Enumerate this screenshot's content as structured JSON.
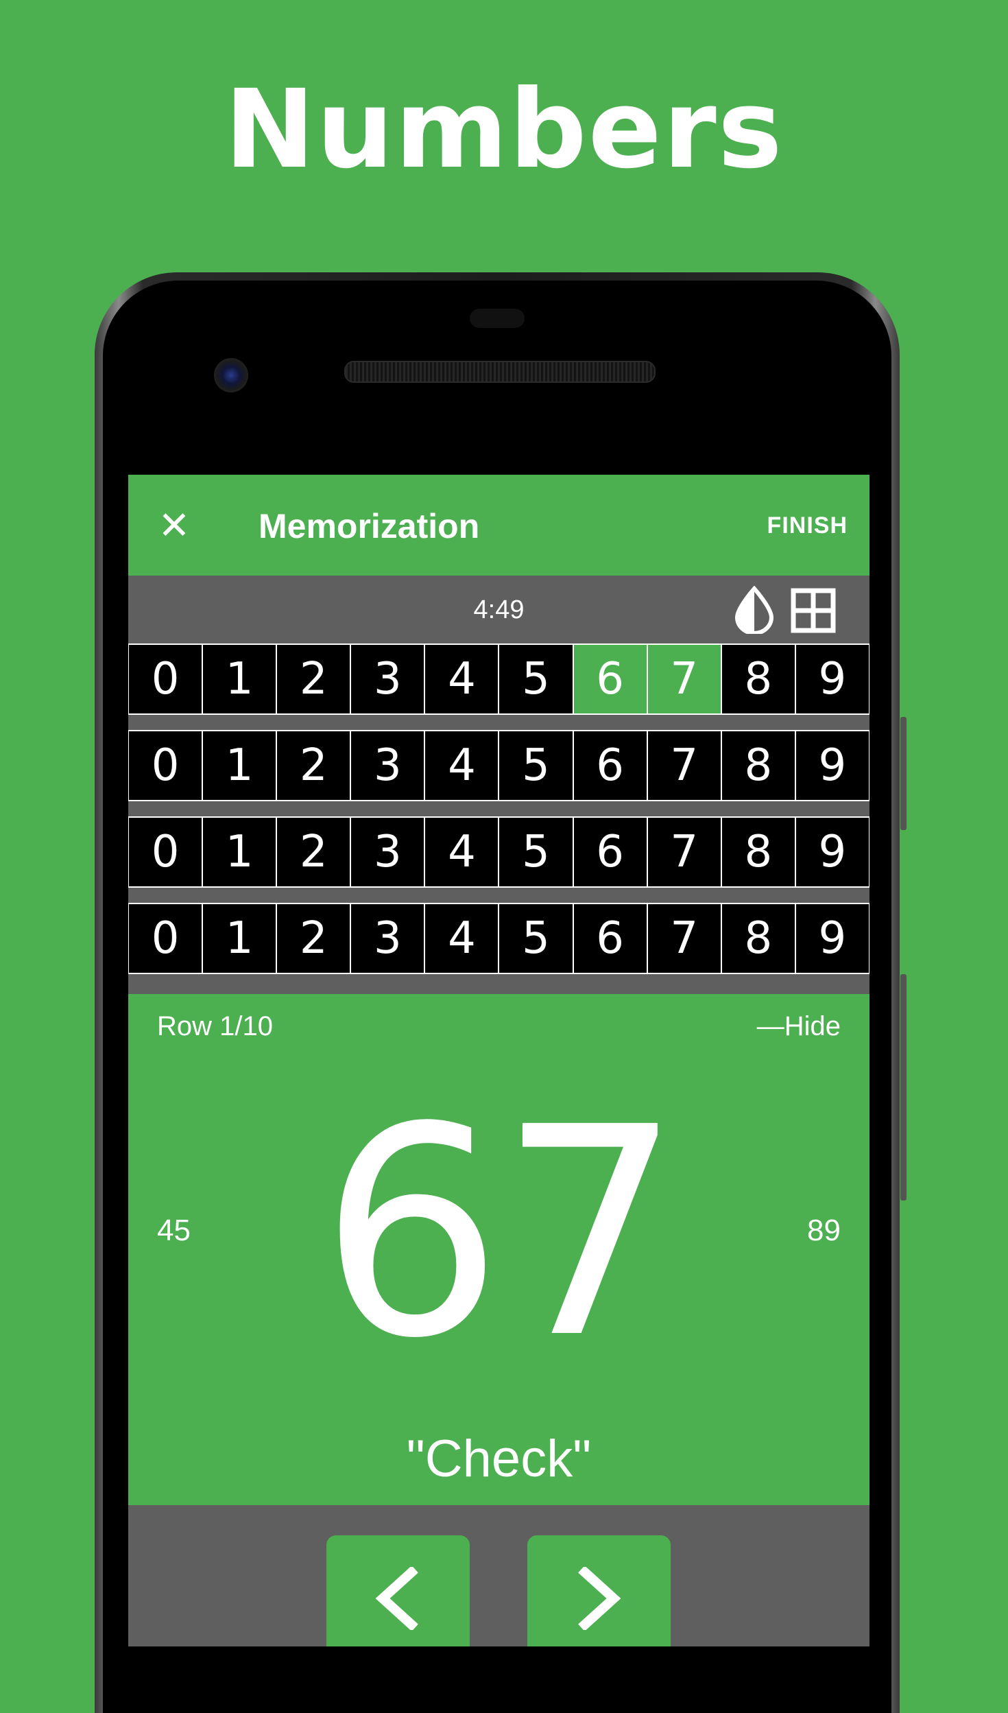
{
  "headline": "Numbers",
  "appbar": {
    "close_icon": "close-icon",
    "title": "Memorization",
    "finish_label": "FINISH"
  },
  "toolbar": {
    "timer": "4:49",
    "icons": [
      "contrast-drop-icon",
      "grid-view-icon"
    ]
  },
  "grid": {
    "rows": [
      {
        "digits": [
          "0",
          "1",
          "2",
          "3",
          "4",
          "5",
          "6",
          "7",
          "8",
          "9"
        ],
        "highlighted": [
          6,
          7
        ]
      },
      {
        "digits": [
          "0",
          "1",
          "2",
          "3",
          "4",
          "5",
          "6",
          "7",
          "8",
          "9"
        ],
        "highlighted": []
      },
      {
        "digits": [
          "0",
          "1",
          "2",
          "3",
          "4",
          "5",
          "6",
          "7",
          "8",
          "9"
        ],
        "highlighted": []
      },
      {
        "digits": [
          "0",
          "1",
          "2",
          "3",
          "4",
          "5",
          "6",
          "7",
          "8",
          "9"
        ],
        "highlighted": []
      }
    ]
  },
  "info": {
    "row_label": "Row 1/10",
    "hide_label": "—Hide",
    "current_number": "67",
    "previous_number": "45",
    "next_number": "89",
    "word": "\"Check\""
  },
  "navigation": {
    "prev_icon": "chevron-left-icon",
    "next_icon": "chevron-right-icon"
  },
  "colors": {
    "brand_green": "#4caf50",
    "panel_gray": "#5f5f5f",
    "cell_black": "#000000"
  }
}
